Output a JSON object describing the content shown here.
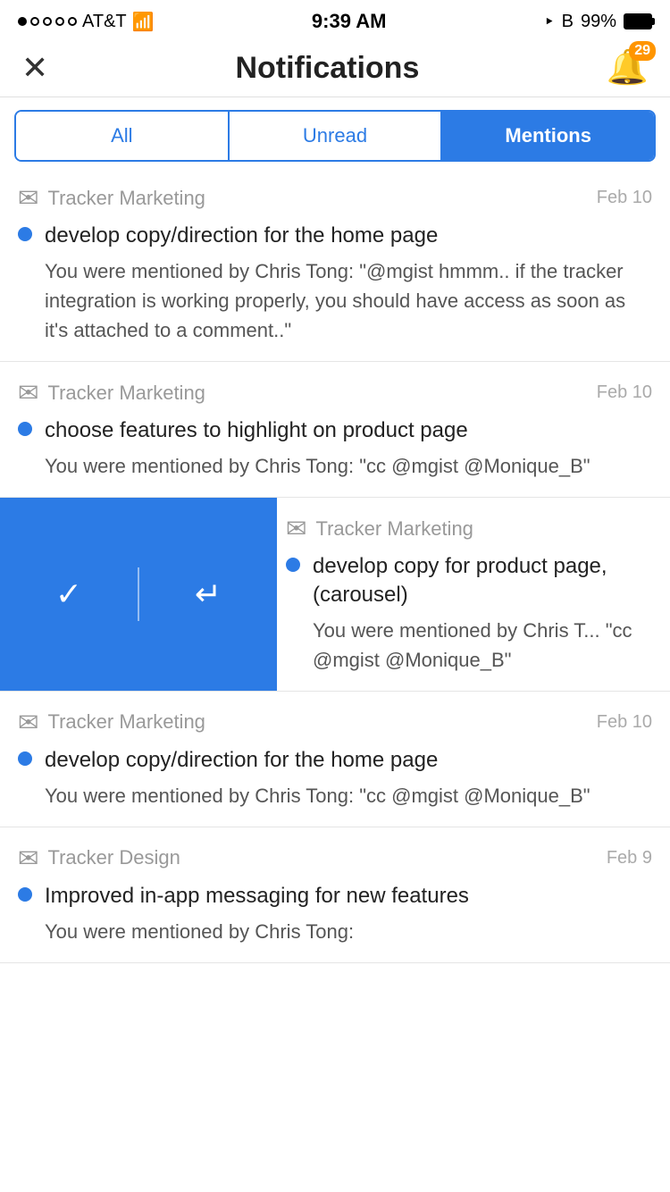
{
  "statusBar": {
    "carrier": "AT&T",
    "time": "9:39 AM",
    "battery": "99%"
  },
  "header": {
    "title": "Notifications",
    "badgeCount": "29"
  },
  "tabs": [
    {
      "label": "All",
      "active": false
    },
    {
      "label": "Unread",
      "active": false
    },
    {
      "label": "Mentions",
      "active": true
    }
  ],
  "notifications": [
    {
      "id": "notif-1",
      "project": "Tracker Marketing",
      "date": "Feb 10",
      "task": "develop copy/direction for the home page",
      "message": "You were mentioned by Chris Tong: \"@mgist hmmm.. if the tracker integration is working properly, you should have access as soon as it's attached to a comment..\"",
      "partial": true
    },
    {
      "id": "notif-2",
      "project": "Tracker Marketing",
      "date": "Feb 10",
      "task": "choose features to highlight on product page",
      "message": "You were mentioned by Chris Tong: \"cc @mgist @Monique_B\"",
      "partial": false
    },
    {
      "id": "notif-3",
      "project": "Tracker Marketing",
      "date": "",
      "task": "develop copy for product page, (carousel)",
      "message": "You were mentioned by Chris T... \"cc @mgist @Monique_B\"",
      "partial": false,
      "swiped": true
    },
    {
      "id": "notif-4",
      "project": "Tracker Marketing",
      "date": "Feb 10",
      "task": "develop copy/direction for the home page",
      "message": "You were mentioned by Chris Tong: \"cc @mgist @Monique_B\"",
      "partial": false
    },
    {
      "id": "notif-5",
      "project": "Tracker Design",
      "date": "Feb 9",
      "task": "Improved in-app messaging for new features",
      "message": "You were mentioned by Chris Tong:",
      "partial": false,
      "partialBottom": true
    }
  ],
  "swipeActions": {
    "check": "✓",
    "reply": "↵"
  }
}
